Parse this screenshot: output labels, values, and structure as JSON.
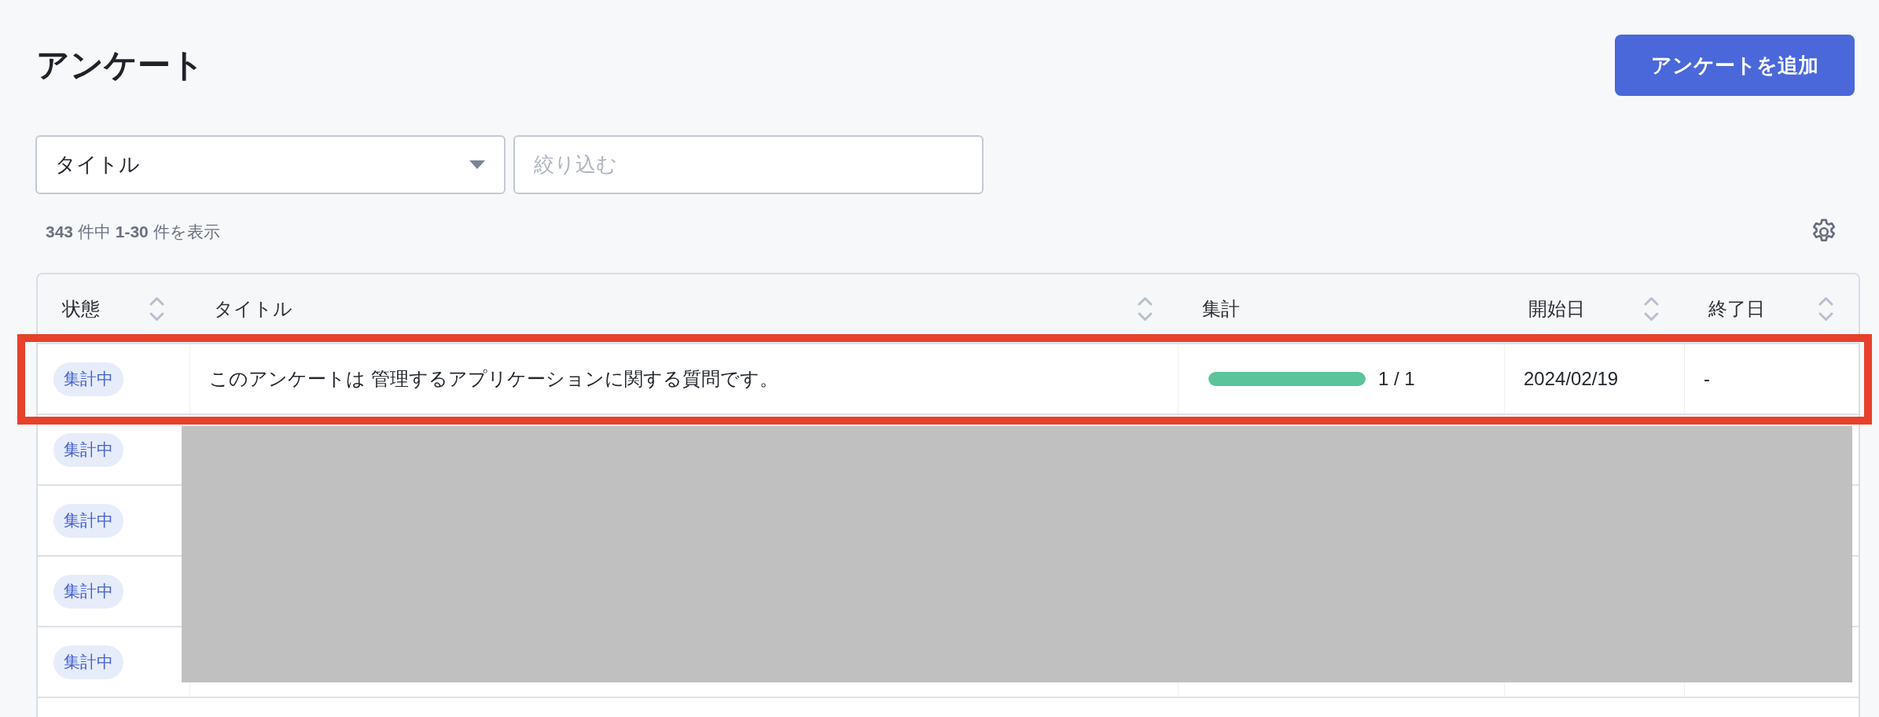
{
  "header": {
    "title": "アンケート",
    "add_button": "アンケートを追加"
  },
  "filters": {
    "field_select": {
      "value": "タイトル"
    },
    "search": {
      "placeholder": "絞り込む"
    }
  },
  "result_count": "**343** 件中 **1-30** 件を表示",
  "table": {
    "columns": [
      {
        "label": "状態",
        "sortable": true
      },
      {
        "label": "タイトル",
        "sortable": true
      },
      {
        "label": "集計",
        "sortable": false
      },
      {
        "label": "開始日",
        "sortable": true
      },
      {
        "label": "終了日",
        "sortable": true
      }
    ],
    "rows": [
      {
        "status": "集計中",
        "title": "このアンケートは 管理するアプリケーションに関する質問です。",
        "progress": {
          "level": 1,
          "reading": "1 / 1"
        },
        "start_date": "2024/02/19",
        "end_date": "-",
        "highlighted": true
      },
      {
        "status": "集計中",
        "highlighted": false
      },
      {
        "status": "集計中",
        "highlighted": false
      },
      {
        "status": "集計中",
        "highlighted": false
      },
      {
        "status": "集計中",
        "highlighted": false
      }
    ]
  }
}
